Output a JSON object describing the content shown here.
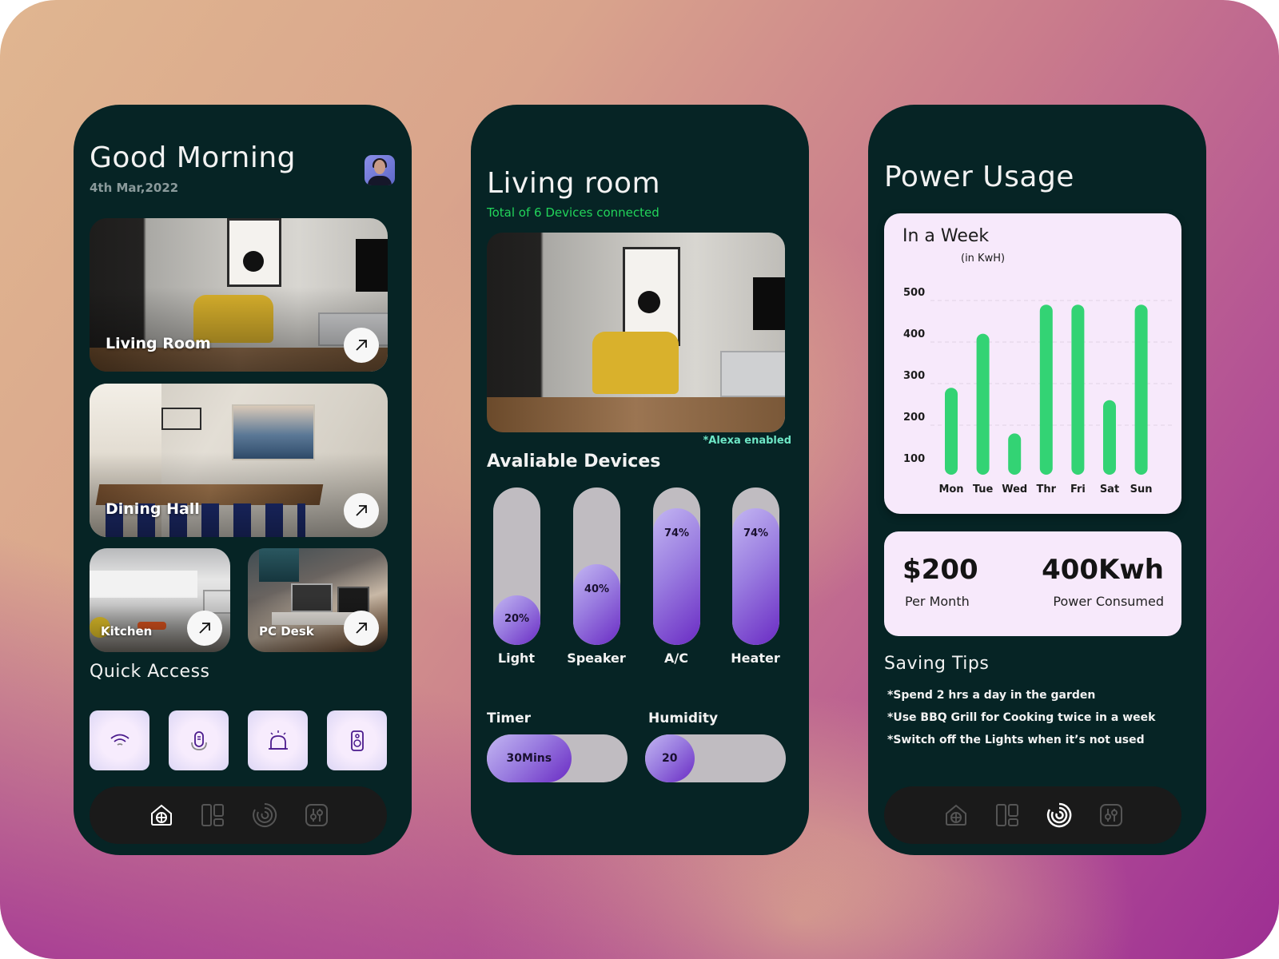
{
  "home": {
    "greeting": "Good Morning",
    "date": "4th Mar,2022",
    "rooms": [
      {
        "label": "Living Room"
      },
      {
        "label": "Dining Hall"
      },
      {
        "label": "Kitchen"
      },
      {
        "label": "PC Desk"
      }
    ],
    "quick_access_title": "Quick Access",
    "quick_access": [
      {
        "icon": "wifi-icon"
      },
      {
        "icon": "smart-speaker-icon"
      },
      {
        "icon": "alarm-light-icon"
      },
      {
        "icon": "speaker-icon"
      }
    ],
    "nav": [
      {
        "icon": "home-icon",
        "active": true
      },
      {
        "icon": "dashboard-icon",
        "active": false
      },
      {
        "icon": "usage-icon",
        "active": false
      },
      {
        "icon": "settings-sliders-icon",
        "active": false
      }
    ]
  },
  "room": {
    "title": "Living room",
    "subtitle": "Total of 6 Devices connected",
    "alexa_note": "*Alexa enabled",
    "devices_title": "Avaliable Devices",
    "devices": [
      {
        "label": "Light",
        "percent": 20,
        "percent_label": "20%"
      },
      {
        "label": "Speaker",
        "percent": 40,
        "percent_label": "40%"
      },
      {
        "label": "A/C",
        "percent": 74,
        "percent_label": "74%"
      },
      {
        "label": "Heater",
        "percent": 74,
        "percent_label": "74%"
      }
    ],
    "timer": {
      "label": "Timer",
      "value": "30Mins",
      "fraction": 0.6
    },
    "humidity": {
      "label": "Humidity",
      "value": "20",
      "fraction": 0.35
    }
  },
  "power": {
    "title": "Power Usage",
    "stats": [
      {
        "value": "$200",
        "caption": "Per Month"
      },
      {
        "value": "400Kwh",
        "caption": "Power Consumed"
      }
    ],
    "tips_title": "Saving Tips",
    "tips": [
      "*Spend 2 hrs a day in the garden",
      "*Use BBQ Grill for Cooking twice in a week",
      "*Switch off the Lights when it’s not used"
    ],
    "nav": [
      {
        "icon": "home-icon",
        "active": false
      },
      {
        "icon": "dashboard-icon",
        "active": false
      },
      {
        "icon": "usage-icon",
        "active": true
      },
      {
        "icon": "settings-sliders-icon",
        "active": false
      }
    ]
  },
  "chart_data": {
    "type": "bar",
    "title": "In a Week",
    "subtitle": "(in KwH)",
    "xlabel": "",
    "ylabel": "",
    "categories": [
      "Mon",
      "Tue",
      "Wed",
      "Thr",
      "Fri",
      "Sat",
      "Sun"
    ],
    "values": [
      290,
      420,
      180,
      490,
      490,
      260,
      490
    ],
    "yticks": [
      100,
      200,
      300,
      400,
      500
    ],
    "ylim": [
      60,
      500
    ],
    "grid": true,
    "bar_color": "#33d374"
  }
}
